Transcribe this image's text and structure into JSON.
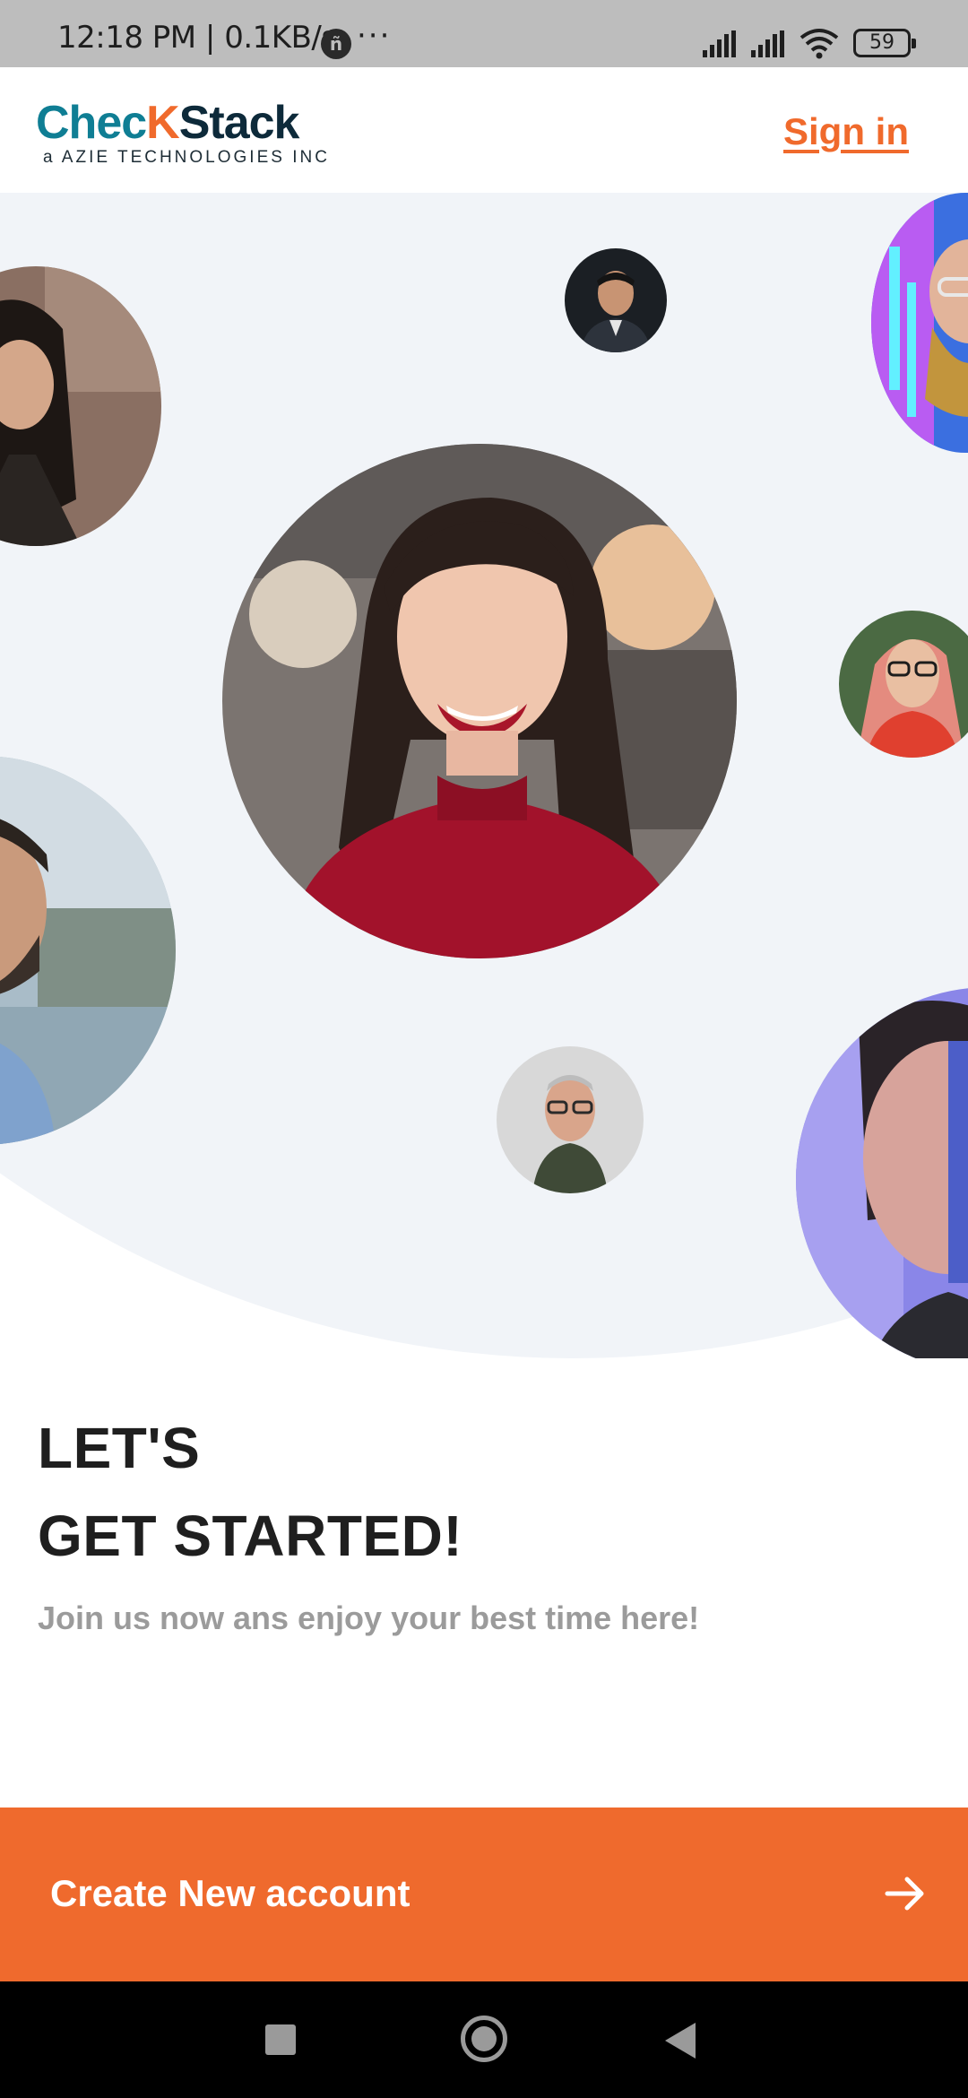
{
  "status_bar": {
    "time_and_speed": "12:18 PM | 0.1KB/s",
    "badge": "ñ",
    "dots": "···",
    "battery": "59",
    "icons": [
      "signal-icon",
      "signal-icon",
      "wifi-icon",
      "battery-icon"
    ]
  },
  "header": {
    "logo_part1": "Chec",
    "logo_k": "K",
    "logo_part2": "Stack",
    "logo_subtitle": "a AZIE TECHNOLOGIES INC",
    "sign_in": "Sign in"
  },
  "hero": {
    "avatars": [
      "woman-portrait-left",
      "man-small-portrait-top",
      "man-neon-portrait-right",
      "smiling-woman-center",
      "woman-glasses-right",
      "bearded-man-left",
      "older-man-glasses",
      "woman-blue-light-right"
    ]
  },
  "content": {
    "headline_line1": "LET'S",
    "headline_line2": "GET STARTED!",
    "subline": "Join us now ans enjoy your best time here!"
  },
  "cta": {
    "label": "Create New account",
    "icon": "arrow-right-icon"
  },
  "nav": {
    "buttons": [
      "back-button",
      "home-button",
      "recents-button"
    ]
  },
  "colors": {
    "accent": "#ef6a2d",
    "brand_teal": "#0f7e94",
    "brand_navy": "#0d2a3a",
    "hero_bg": "#f1f4f8",
    "headline": "#1f1f1f",
    "subline": "#9b9b9b"
  }
}
